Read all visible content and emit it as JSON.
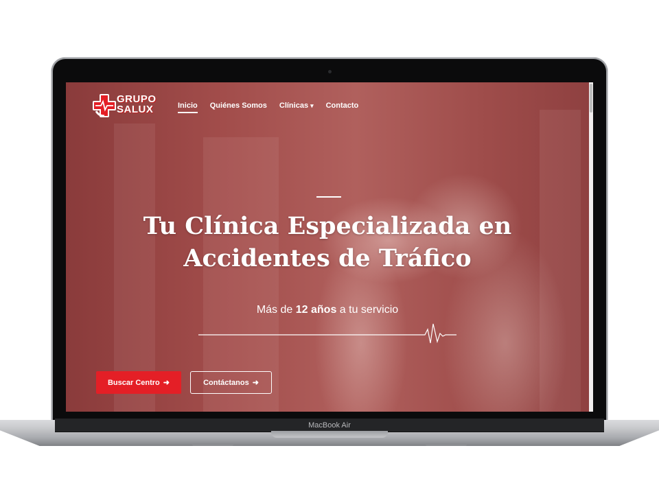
{
  "device": {
    "label": "MacBook Air"
  },
  "site": {
    "logo": {
      "line1": "GRUPO",
      "line2": "SALUX",
      "accent_color": "#e41f26"
    },
    "nav": {
      "items": [
        {
          "label": "Inicio",
          "active": true
        },
        {
          "label": "Quiénes Somos",
          "active": false
        },
        {
          "label": "Clínicas",
          "active": false,
          "dropdown": true
        },
        {
          "label": "Contacto",
          "active": false
        }
      ],
      "dropdown_icon": "▾"
    },
    "hero": {
      "title_line1": "Tu Clínica Especializada en",
      "title_line2": "Accidentes de Tráfico",
      "subtitle_before": "Más de ",
      "subtitle_bold": "12 años",
      "subtitle_after": " a tu servicio",
      "overlay_color": "#a04a48"
    },
    "buttons": {
      "primary_label": "Buscar Centro",
      "secondary_label": "Contáctanos",
      "arrow": "➜",
      "primary_color": "#e41f26"
    }
  }
}
